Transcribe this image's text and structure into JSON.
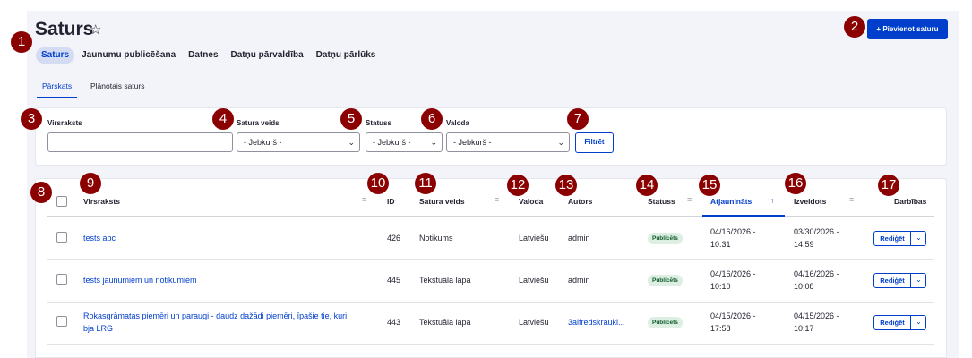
{
  "header": {
    "title": "Saturs",
    "favorite_icon": "star-icon",
    "add_button": "+ Pievienot saturu"
  },
  "primary_tabs": [
    "Saturs",
    "Jaunumu publicēšana",
    "Datnes",
    "Datņu pārvaldība",
    "Datņu pārlūks"
  ],
  "secondary_tabs": [
    "Pārskats",
    "Plānotais saturs"
  ],
  "filters": {
    "title_label": "Virsraksts",
    "title_value": "",
    "type_label": "Satura veids",
    "type_value": "- Jebkurš -",
    "status_label": "Statuss",
    "status_value": "- Jebkurš -",
    "language_label": "Valoda",
    "language_value": "- Jebkurš -",
    "filter_button": "Filtrēt"
  },
  "table": {
    "columns": [
      "Virsraksts",
      "ID",
      "Satura veids",
      "Valoda",
      "Autors",
      "Statuss",
      "Atjaunināts",
      "Izveidots",
      "Darbības"
    ],
    "sorted_icon": "arrow-up-icon",
    "rows": [
      {
        "title": "tests abc",
        "id": "426",
        "type": "Notikums",
        "language": "Latviešu",
        "author": "admin",
        "status": "Publicēts",
        "updated_date": "04/16/2026 -",
        "updated_time": "10:31",
        "created_date": "03/30/2026 -",
        "created_time": "14:59",
        "action": "Rediģēt"
      },
      {
        "title": "tests jaunumiem un notikumiem",
        "id": "445",
        "type": "Tekstuāla lapa",
        "language": "Latviešu",
        "author": "admin",
        "status": "Publicēts",
        "updated_date": "04/16/2026 -",
        "updated_time": "10:10",
        "created_date": "04/16/2026 -",
        "created_time": "10:08",
        "action": "Rediģēt"
      },
      {
        "title_line1": "Rokasgrāmatas piemēri un paraugi - daudz dažādi piemēri, īpašie tie, kuri",
        "title_line2": "bja LRG",
        "id": "443",
        "type": "Tekstuāla lapa",
        "language": "Latviešu",
        "author": "3alfredskraukl...",
        "status": "Publicēts",
        "updated_date": "04/15/2026 -",
        "updated_time": "17:58",
        "created_date": "04/15/2026 -",
        "created_time": "10:17",
        "action": "Rediģēt"
      }
    ]
  },
  "markers": [
    "1",
    "2",
    "3",
    "4",
    "5",
    "6",
    "7",
    "8",
    "9",
    "10",
    "11",
    "12",
    "13",
    "14",
    "15",
    "16",
    "17"
  ],
  "colors": {
    "accent": "#003ecc",
    "marker": "#8b0000",
    "badge_bg": "#dcefe2"
  }
}
